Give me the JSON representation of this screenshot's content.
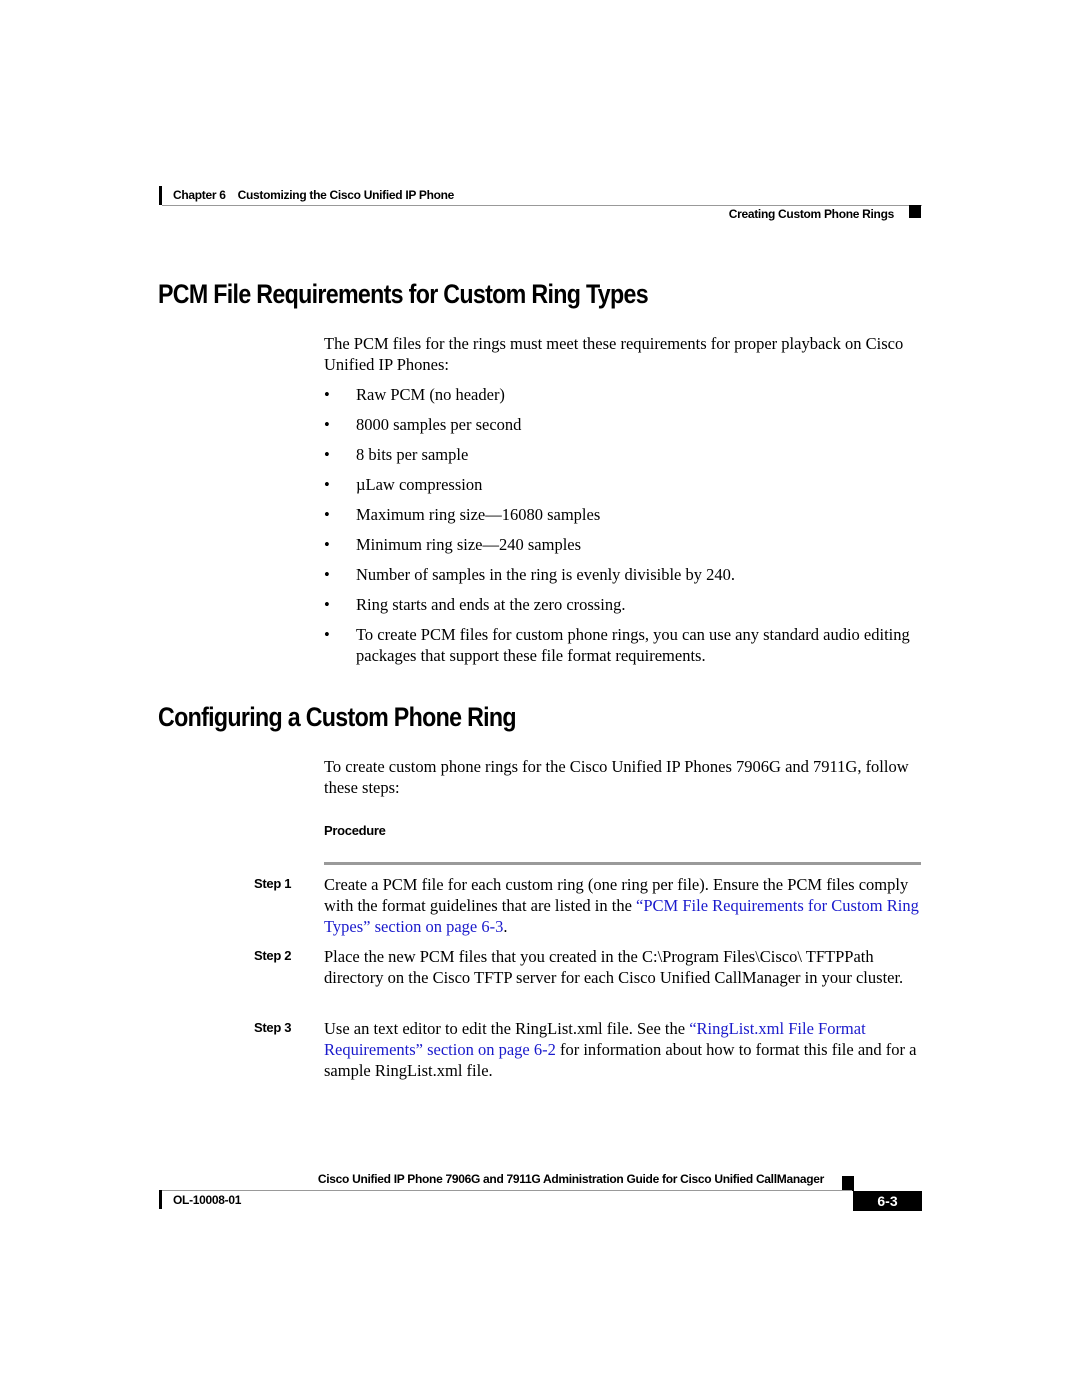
{
  "header": {
    "chapter_label": "Chapter 6",
    "chapter_title": "Customizing the Cisco Unified IP Phone",
    "section_title": "Creating Custom Phone Rings"
  },
  "section1": {
    "heading": "PCM File Requirements for Custom Ring Types",
    "intro": "The PCM files for the rings must meet these requirements for proper playback on Cisco Unified IP Phones:",
    "bullet_glyph": "•",
    "bullets": [
      "Raw PCM (no header)",
      "8000 samples per second",
      "8 bits per sample",
      "µLaw compression",
      "Maximum ring size—16080 samples",
      "Minimum ring size—240 samples",
      "Number of samples in the ring is evenly divisible by 240.",
      "Ring starts and ends at the zero crossing.",
      "To create PCM files for custom phone rings, you can use any standard audio editing packages that support these file format requirements."
    ]
  },
  "section2": {
    "heading": "Configuring a Custom Phone Ring",
    "intro": "To create custom phone rings for the Cisco Unified IP Phones 7906G and 7911G, follow these steps:",
    "procedure_label": "Procedure",
    "steps": [
      {
        "label": "Step 1",
        "text_before": "Create a PCM file for each custom ring (one ring per file). Ensure the PCM files comply with the format guidelines that are listed in the ",
        "link": "“PCM File Requirements for Custom Ring Types” section on page 6-3",
        "text_after": "."
      },
      {
        "label": "Step 2",
        "text_before": "Place the new PCM files that you created in the C:\\Program Files\\Cisco\\ TFTPPath directory on the Cisco TFTP server for each Cisco Unified CallManager in your cluster.",
        "link": "",
        "text_after": ""
      },
      {
        "label": "Step 3",
        "text_before": "Use an text editor to edit the RingList.xml file. See the ",
        "link": "“RingList.xml File Format Requirements” section on page 6-2",
        "text_after": " for information about how to format this file and for a sample RingList.xml file."
      }
    ]
  },
  "footer": {
    "guide_title": "Cisco Unified IP Phone 7906G and 7911G Administration Guide for Cisco Unified CallManager",
    "doc_number": "OL-10008-01",
    "page_number": "6-3"
  },
  "colors": {
    "link": "#1a1acc",
    "rule": "#999999",
    "text": "#000000"
  }
}
